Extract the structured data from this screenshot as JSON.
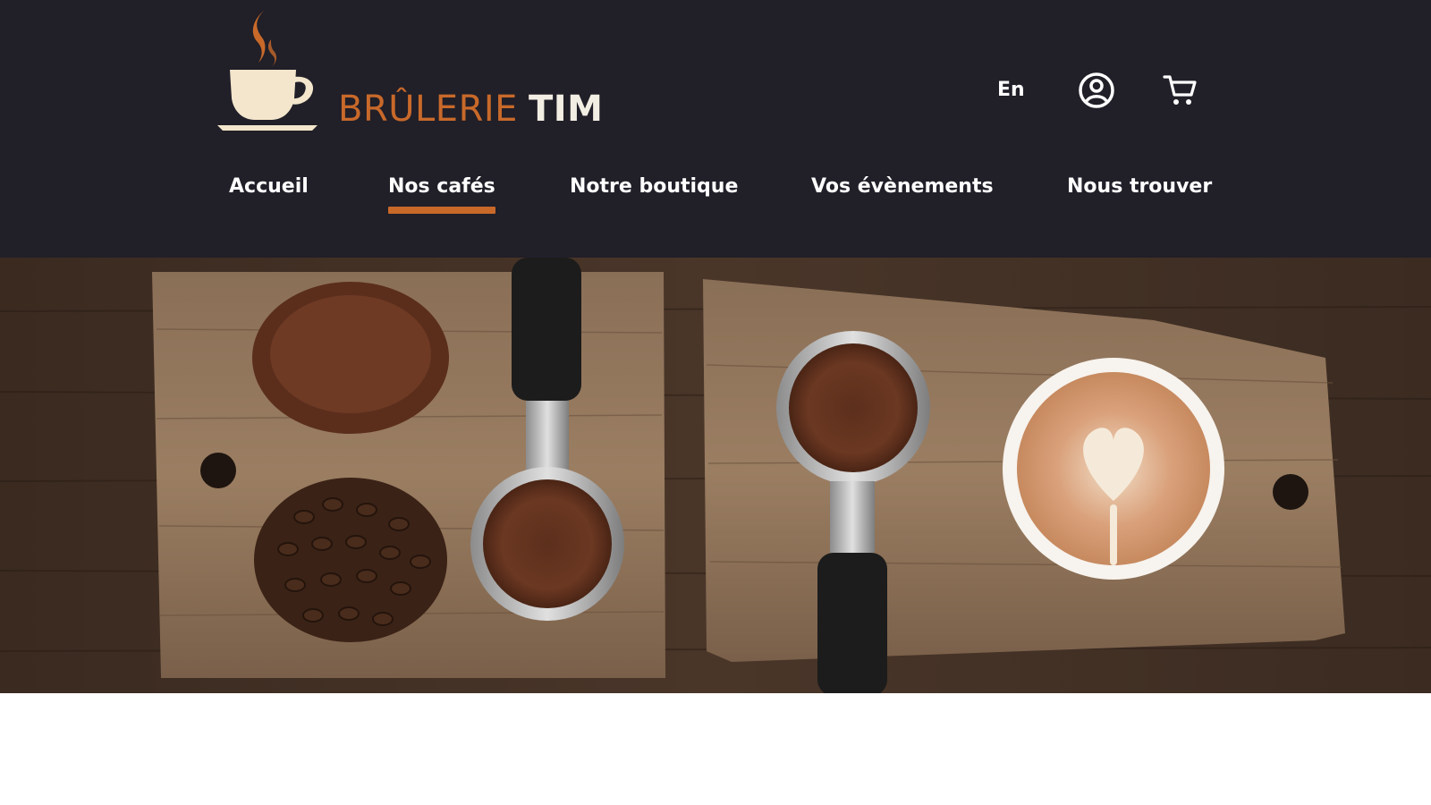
{
  "brand": {
    "name_first": "BRÛLERIE",
    "name_second": "TIM",
    "accent_color": "#c8692a",
    "header_bg": "#211f28"
  },
  "utility": {
    "language": "En",
    "account_icon": "account-circle-icon",
    "cart_icon": "shopping-cart-icon"
  },
  "nav": {
    "items": [
      {
        "label": "Accueil",
        "active": false
      },
      {
        "label": "Nos cafés",
        "active": true
      },
      {
        "label": "Notre boutique",
        "active": false
      },
      {
        "label": "Vos évènements",
        "active": false
      },
      {
        "label": "Nous trouver",
        "active": false
      }
    ]
  },
  "hero": {
    "image": "hero-coffee-photo"
  }
}
